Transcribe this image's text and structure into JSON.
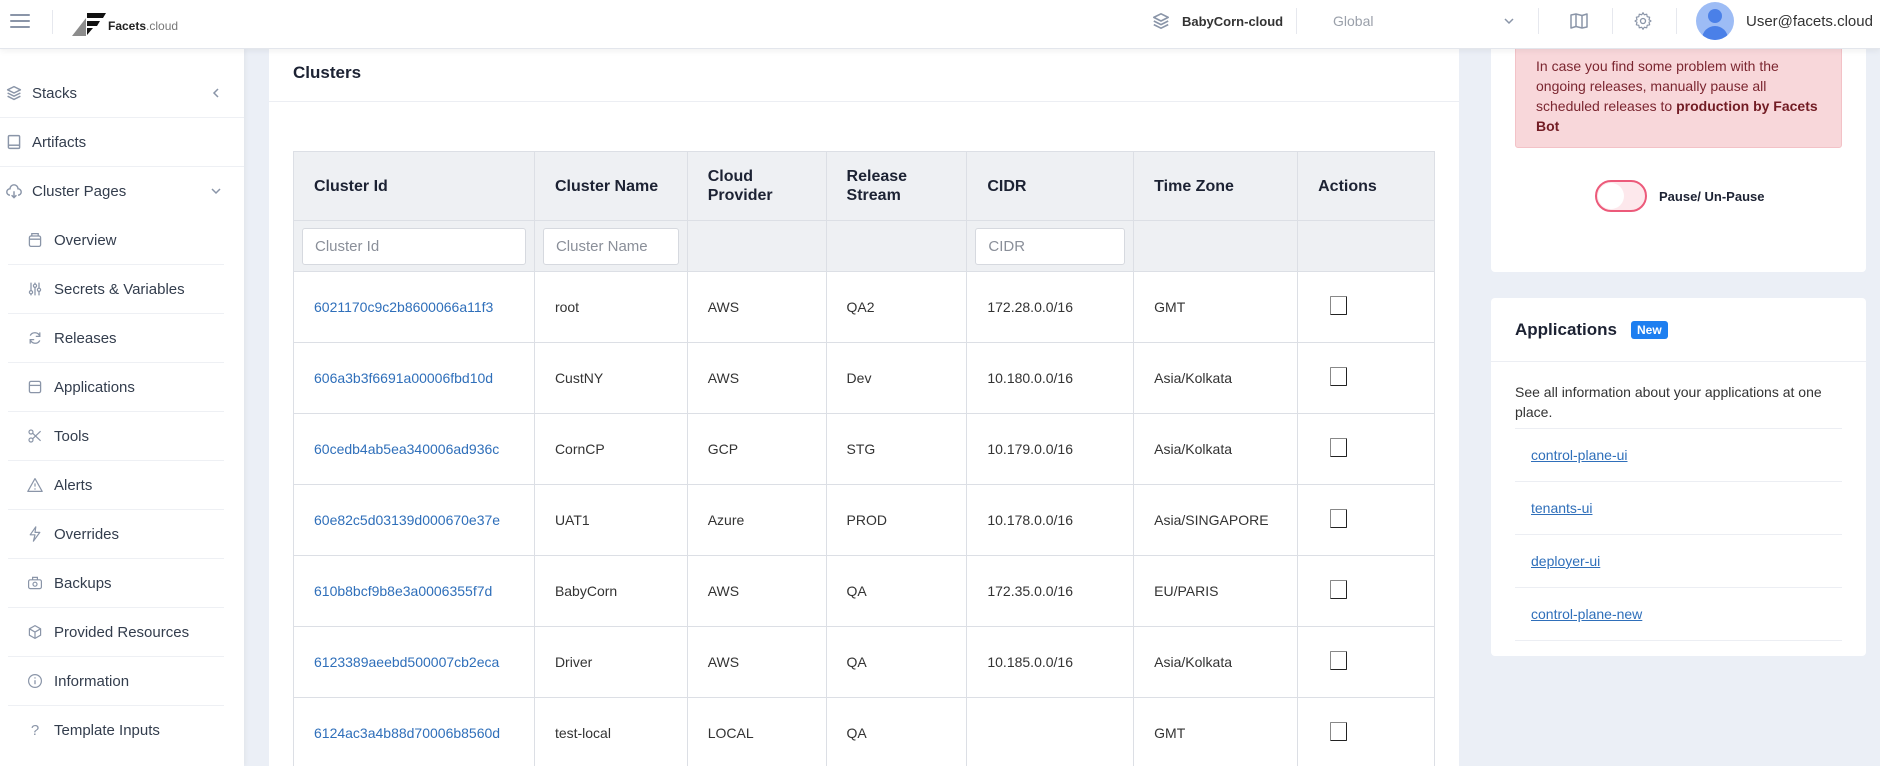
{
  "header": {
    "brand_main": "Facets",
    "brand_suffix": ".cloud",
    "project_name": "BabyCorn-cloud",
    "environment": "Global",
    "user_email": "User@facets.cloud",
    "icons": [
      "menu-icon",
      "stack-icon",
      "chevron-down-icon",
      "book-icon",
      "gear-icon",
      "user-avatar-icon"
    ]
  },
  "sidebar": {
    "top_items": [
      {
        "label": "Stacks",
        "icon": "layers-icon",
        "chevron": "left"
      },
      {
        "label": "Artifacts",
        "icon": "book-icon"
      },
      {
        "label": "Cluster Pages",
        "icon": "cloud-download-icon",
        "chevron": "down"
      }
    ],
    "sub_items": [
      {
        "label": "Overview",
        "icon": "overview-icon"
      },
      {
        "label": "Secrets & Variables",
        "icon": "sliders-icon"
      },
      {
        "label": "Releases",
        "icon": "refresh-icon"
      },
      {
        "label": "Applications",
        "icon": "window-icon"
      },
      {
        "label": "Tools",
        "icon": "scissors-icon"
      },
      {
        "label": "Alerts",
        "icon": "alert-triangle-icon"
      },
      {
        "label": "Overrides",
        "icon": "zap-icon"
      },
      {
        "label": "Backups",
        "icon": "camera-icon"
      },
      {
        "label": "Provided Resources",
        "icon": "box-icon"
      },
      {
        "label": "Information",
        "icon": "info-icon"
      },
      {
        "label": "Template Inputs",
        "icon": "question-icon"
      }
    ]
  },
  "main": {
    "title": "Clusters",
    "columns": [
      "Cluster Id",
      "Cluster Name",
      "Cloud Provider",
      "Release Stream",
      "CIDR",
      "Time Zone",
      "Actions"
    ],
    "filters": {
      "cluster_id_placeholder": "Cluster Id",
      "cluster_name_placeholder": "Cluster Name",
      "cidr_placeholder": "CIDR"
    },
    "rows": [
      {
        "id": "6021170c9c2b8600066a11f3",
        "name": "root",
        "cloud": "AWS",
        "stream": "QA2",
        "cidr": "172.28.0.0/16",
        "tz": "GMT",
        "checked": false
      },
      {
        "id": "606a3b3f6691a00006fbd10d",
        "name": "CustNY",
        "cloud": "AWS",
        "stream": "Dev",
        "cidr": "10.180.0.0/16",
        "tz": "Asia/Kolkata",
        "checked": false
      },
      {
        "id": "60cedb4ab5ea340006ad936c",
        "name": "CornCP",
        "cloud": "GCP",
        "stream": "STG",
        "cidr": "10.179.0.0/16",
        "tz": "Asia/Kolkata",
        "checked": false
      },
      {
        "id": "60e82c5d03139d000670e37e",
        "name": "UAT1",
        "cloud": "Azure",
        "stream": "PROD",
        "cidr": "10.178.0.0/16",
        "tz": "Asia/SINGAPORE",
        "checked": false
      },
      {
        "id": "610b8bcf9b8e3a0006355f7d",
        "name": "BabyCorn",
        "cloud": "AWS",
        "stream": "QA",
        "cidr": "172.35.0.0/16",
        "tz": "EU/PARIS",
        "checked": false
      },
      {
        "id": "6123389aeebd500007cb2eca",
        "name": "Driver",
        "cloud": "AWS",
        "stream": "QA",
        "cidr": "10.185.0.0/16",
        "tz": "Asia/Kolkata",
        "checked": false
      },
      {
        "id": "6124ac3a4b88d70006b8560d",
        "name": "test-local",
        "cloud": "LOCAL",
        "stream": "QA",
        "cidr": "",
        "tz": "GMT",
        "checked": false
      }
    ]
  },
  "pause_card": {
    "alert_text": "In case you find some problem with the ongoing releases, manually pause all scheduled releases to ",
    "alert_bold": "production by Facets Bot",
    "toggle_label": "Pause/ Un-Pause",
    "toggle_on": false
  },
  "applications_card": {
    "title": "Applications",
    "badge": "New",
    "description": "See all information about your applications at one place.",
    "apps": [
      "control-plane-ui",
      "tenants-ui",
      "deployer-ui",
      "control-plane-new"
    ]
  },
  "colors": {
    "link": "#2f6fba",
    "badge": "#1e7ff0",
    "alert_bg": "#f8d7da",
    "toggle_border": "#ec5a7a",
    "page_bg": "#ebeff6"
  }
}
